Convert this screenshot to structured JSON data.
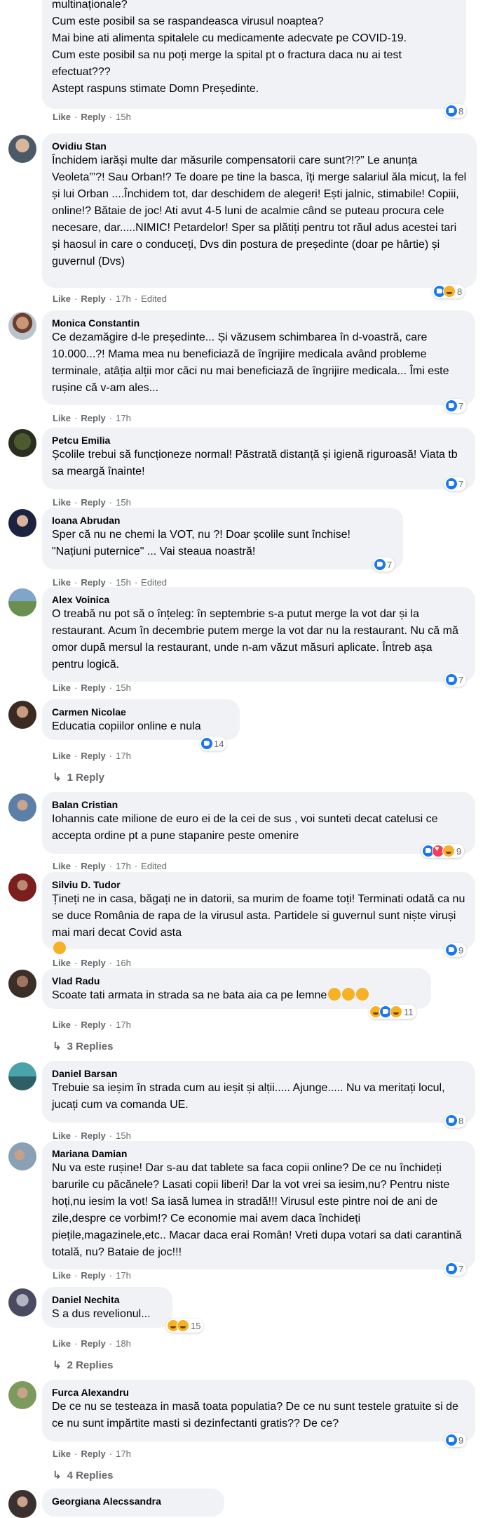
{
  "comments": [
    {
      "author": "",
      "text": "multinaționale?\nCum este posibil sa se raspandeasca virusul noaptea?\nMai bine ati alimenta spitalele cu medicamente adecvate pe COVID-19.\nCum este posibil sa nu poți merge la spital pt o fractura daca nu ai test efectuat???\nAstept raspuns stimate Domn Președinte.",
      "time": "15h",
      "edited": "",
      "reactions": "8"
    },
    {
      "author": "Ovidiu Stan",
      "text": "Închidem iarăși multe dar măsurile compensatorii care sunt?!?” Le anunța Veoleta”’?! Sau Orban!? Te doare pe tine la basca, îți merge salariul ăla micuț, la fel și lui Orban ....Închidem tot, dar deschidem de alegeri! Ești jalnic, stimabile! Copiii, online!? Bătaie de joc! Ati avut 4-5 luni de acalmie când se puteau procura cele necesare, dar.....NIMIC! Petardelor! Sper sa plătiți pentru tot răul adus acestei tari și haosul in care o conduceți, Dvs din postura de președinte (doar pe hârtie) și guvernul (Dvs)",
      "time": "17h",
      "edited": "Edited",
      "reactions": "8"
    },
    {
      "author": "Monica Constantin",
      "text": "Ce dezamăgire d-le președinte... Și văzusem schimbarea în d-voastră, care 10.000...?! Mama mea nu beneficiază de îngrijire medicala având probleme terminale, atâția alții mor căci nu mai beneficiază de îngrijire medicala... Îmi este rușine că v-am ales...",
      "time": "17h",
      "edited": "",
      "reactions": "7"
    },
    {
      "author": "Petcu Emilia",
      "text": "Școlile trebui să funcționeze normal! Păstrată distanță și igienă riguroasă! Viata tb sa meargă înainte!",
      "time": "15h",
      "edited": "",
      "reactions": "7"
    },
    {
      "author": "Ioana Abrudan",
      "text": "Sper că nu ne chemi la VOT, nu ?! Doar școlile sunt închise!\n\"Națiuni puternice\" ... Vai steaua noastră!",
      "time": "15h",
      "edited": "Edited",
      "reactions": "7"
    },
    {
      "author": "Alex Voinica",
      "text": "O treabă nu pot să o înțeleg: în septembrie s-a putut merge la vot dar și la restaurant. Acum în decembrie putem merge la vot dar nu la restaurant. Nu că mă omor după mersul la restaurant, unde n-am văzut măsuri aplicate. Întreb așa pentru logică.",
      "time": "15h",
      "edited": "",
      "reactions": "7"
    },
    {
      "author": "Carmen Nicolae",
      "text": "Educatia copiilor online e nula",
      "time": "17h",
      "edited": "",
      "reactions": "14",
      "replies": "1 Reply"
    },
    {
      "author": "Balan Cristian",
      "text": "Iohannis cate milione de euro ei de la cei de sus , voi sunteti decat catelusi ce accepta ordine pt a pune stapanire peste omenire",
      "time": "17h",
      "edited": "Edited",
      "reactions": "9"
    },
    {
      "author": "Silviu D. Tudor",
      "text": "Țineți ne in casa, băgați ne in datorii, sa murim de foame toți! Terminati odată ca nu se duce România de rapa de la virusul asta. Partidele si guvernul sunt niște viruși mai mari decat Covid asta",
      "time": "16h",
      "edited": "",
      "reactions": "9"
    },
    {
      "author": "Vlad Radu",
      "text": "Scoate tati armata in strada sa ne bata aia ca pe lemne",
      "time": "17h",
      "edited": "",
      "reactions": "11",
      "replies": "3 Replies"
    },
    {
      "author": "Daniel Barsan",
      "text": "Trebuie sa ieșim în strada cum au ieșit și alții..... Ajunge..... Nu va meritați locul, jucați cum va comanda UE.",
      "time": "15h",
      "edited": "",
      "reactions": "8"
    },
    {
      "author": "Mariana Damian",
      "text": "Nu va este rușine! Dar s-au dat tablete sa faca copii online? De ce nu închideți barurile cu păcănele? Lasati copii liberi! Dar la vot vrei sa iesim,nu? Pentru niste hoți,nu iesim la vot! Sa iasă lumea in stradă!!! Virusul este pintre noi de ani de zile,despre ce vorbim!? Ce economie mai avem daca închideți piețile,magazinele,etc.. Macar daca erai Român! Vreti dupa votari sa dati carantină totală, nu? Bataie de joc!!!",
      "time": "17h",
      "edited": "",
      "reactions": "7"
    },
    {
      "author": "Daniel Nechita",
      "text": "S a dus revelionul...",
      "time": "18h",
      "edited": "",
      "reactions": "15",
      "replies": "2 Replies"
    },
    {
      "author": "Furca Alexandru",
      "text": "De ce nu se testeaza in masă toata populatia? De ce nu sunt testele gratuite si de ce nu sunt impărtite masti si dezinfectanti gratis?? De ce?",
      "time": "17h",
      "edited": "",
      "reactions": "9",
      "replies": "4 Replies"
    },
    {
      "author": "Georgiana Alecssandra",
      "text": "",
      "time": "",
      "edited": "",
      "reactions": ""
    }
  ],
  "labels": {
    "like": "Like",
    "reply": "Reply",
    "dot": "·"
  },
  "colors": {
    "bubble": "#f0f2f5",
    "meta": "#65676b",
    "like_blue": "#1877f2",
    "love_red": "#f33e58",
    "emoji_yellow": "#f7b125"
  }
}
